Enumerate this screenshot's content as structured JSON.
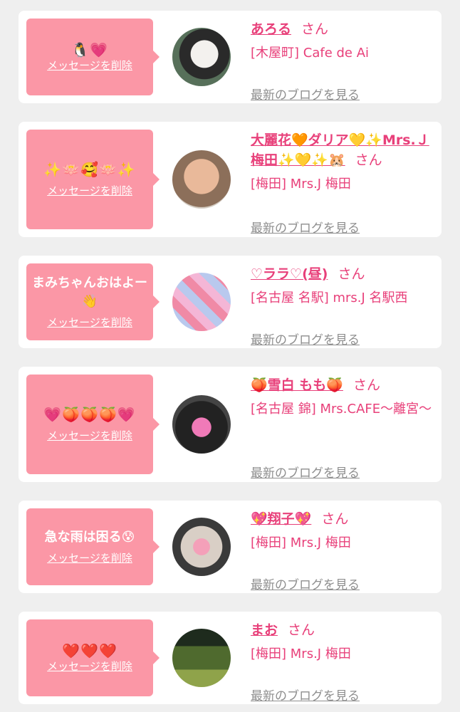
{
  "items": [
    {
      "message": "",
      "emoji": "🐧💗",
      "delete_label": "メッセージを削除",
      "name": "あろる",
      "san": "さん",
      "shop": "[木屋町] Cafe de Ai",
      "blog_label": "最新のブログを見る"
    },
    {
      "message": "",
      "emoji": "✨🪷🥰🪷✨",
      "delete_label": "メッセージを削除",
      "name": "大麗花🧡ダリア💛✨Mrs.Ｊ梅田✨💛✨🐹",
      "san": "さん",
      "shop": "[梅田] Mrs.J 梅田",
      "blog_label": "最新のブログを見る"
    },
    {
      "message": "まみちゃんおはよー👋",
      "emoji": "",
      "delete_label": "メッセージを削除",
      "name": "♡ララ♡(昼)",
      "san": "さん",
      "shop": "[名古屋 名駅] mrs.J 名駅西",
      "blog_label": "最新のブログを見る"
    },
    {
      "message": "",
      "emoji": "💗🍑🍑🍑💗",
      "delete_label": "メッセージを削除",
      "name": "🍑雪白 もも🍑",
      "san": "さん",
      "shop": "[名古屋 錦] Mrs.CAFE〜離宮〜",
      "blog_label": "最新のブログを見る"
    },
    {
      "message": "急な雨は困る😰",
      "emoji": "",
      "delete_label": "メッセージを削除",
      "name": "💖翔子💖",
      "san": "さん",
      "shop": "[梅田] Mrs.J 梅田",
      "blog_label": "最新のブログを見る"
    },
    {
      "message": "",
      "emoji": "❤️❤️❤️",
      "delete_label": "メッセージを削除",
      "name": "まお",
      "san": "さん",
      "shop": "[梅田] Mrs.J 梅田",
      "blog_label": "最新のブログを見る"
    }
  ]
}
